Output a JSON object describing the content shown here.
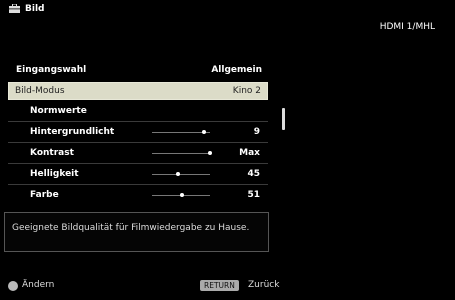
{
  "header": {
    "title": "Bild",
    "input": "HDMI 1/MHL"
  },
  "menu": {
    "header_row": {
      "label": "Eingangswahl",
      "value": "Allgemein"
    },
    "selected_row": {
      "label": "Bild-Modus",
      "value": "Kino 2"
    },
    "rows": [
      {
        "label": "Normwerte",
        "value": "",
        "level": null
      },
      {
        "label": "Hintergrundlicht",
        "value": "9",
        "level": 0.9
      },
      {
        "label": "Kontrast",
        "value": "Max",
        "level": 1.0
      },
      {
        "label": "Helligkeit",
        "value": "45",
        "level": 0.45
      },
      {
        "label": "Farbe",
        "value": "51",
        "level": 0.51
      }
    ]
  },
  "description": "Geeignete Bildqualität für Filmwiedergabe zu Hause.",
  "footer": {
    "change_label": "Ändern",
    "return_label": "RETURN",
    "back_label": "Zurück"
  }
}
